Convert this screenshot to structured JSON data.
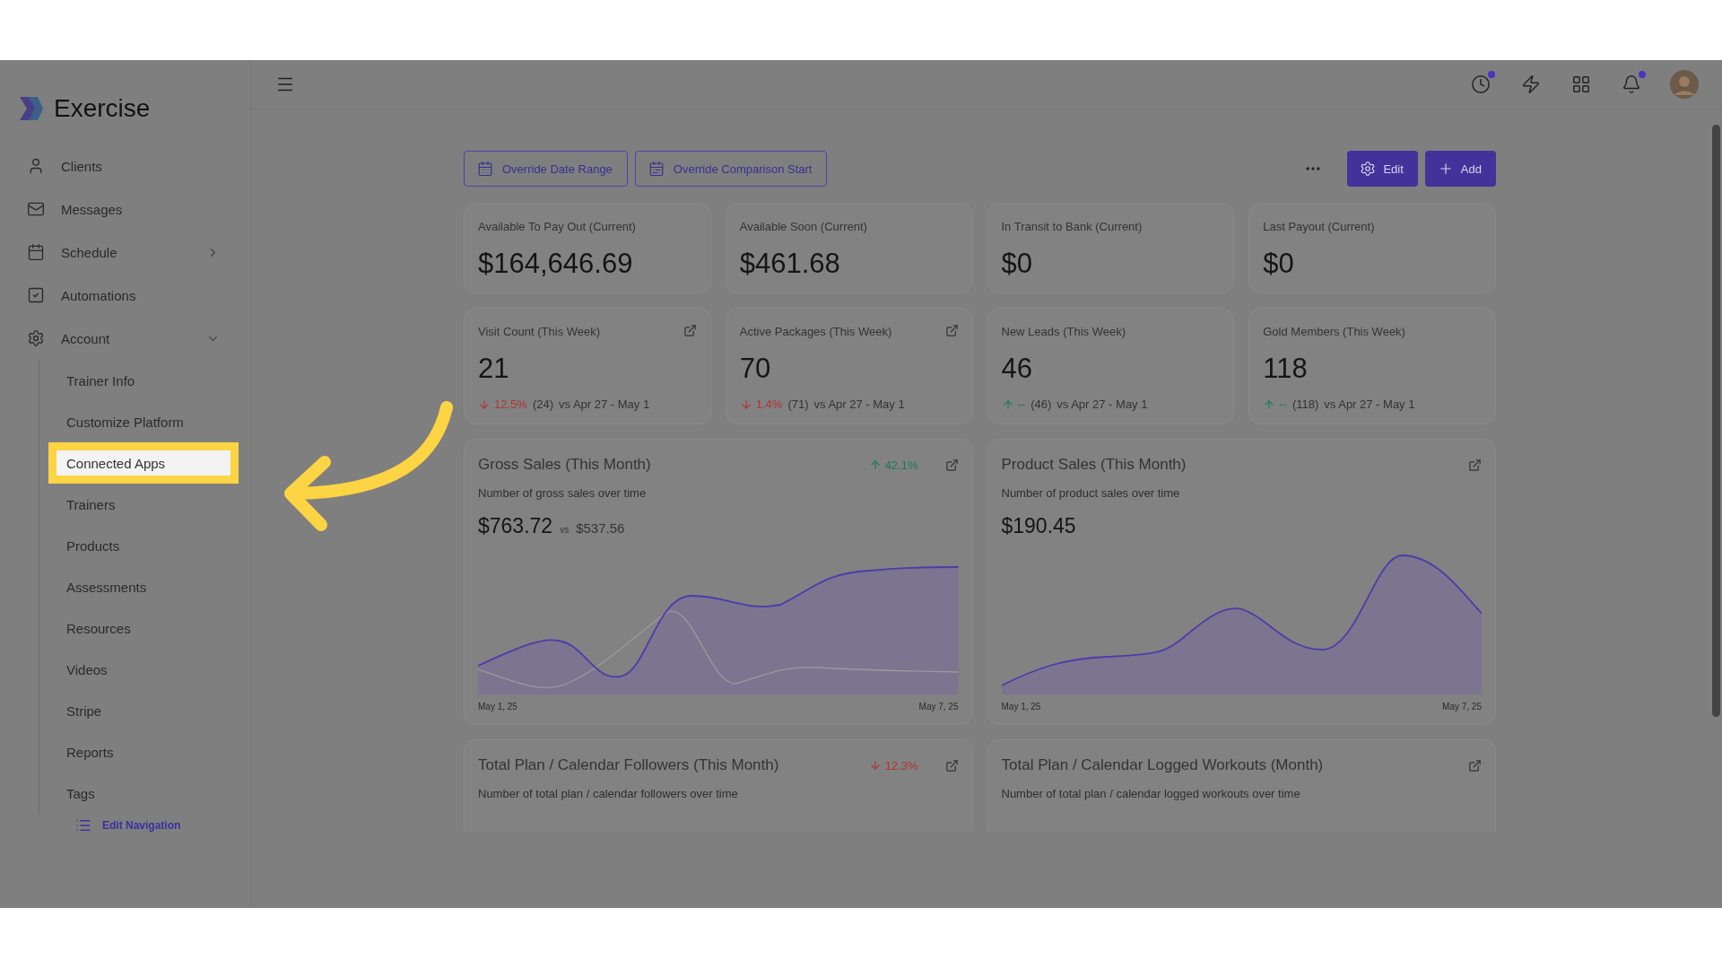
{
  "brand": {
    "name": "Exercise"
  },
  "nav": [
    {
      "label": "Clients"
    },
    {
      "label": "Messages"
    },
    {
      "label": "Schedule",
      "expanded": false
    },
    {
      "label": "Automations"
    },
    {
      "label": "Account",
      "expanded": true,
      "children": [
        {
          "label": "Trainer Info",
          "selected": false
        },
        {
          "label": "Customize Platform",
          "selected": false
        },
        {
          "label": "Connected Apps",
          "selected": true
        },
        {
          "label": "Trainers",
          "selected": false
        },
        {
          "label": "Products",
          "selected": false
        },
        {
          "label": "Assessments",
          "selected": false
        },
        {
          "label": "Resources",
          "selected": false
        },
        {
          "label": "Videos",
          "selected": false
        },
        {
          "label": "Stripe",
          "selected": false
        },
        {
          "label": "Reports",
          "selected": false
        },
        {
          "label": "Tags",
          "selected": false
        }
      ]
    }
  ],
  "edit_navigation": "Edit Navigation",
  "topbar": {
    "history_badge": true,
    "alerts_badge": true
  },
  "toolbar": {
    "buttons": [
      {
        "label": "Override Date Range"
      },
      {
        "label": "Override Comparison Start"
      }
    ],
    "edit": "Edit",
    "add": "Add"
  },
  "stats": [
    {
      "label": "Available To Pay Out (Current)",
      "value": "$164,646.69",
      "linked": false
    },
    {
      "label": "Available Soon (Current)",
      "value": "$461.68",
      "linked": false
    },
    {
      "label": "In Transit to Bank (Current)",
      "value": "$0",
      "linked": false
    },
    {
      "label": "Last Payout (Current)",
      "value": "$0",
      "linked": false
    },
    {
      "label": "Visit Count (This Week)",
      "value": "21",
      "linked": true,
      "trend": {
        "rising": false,
        "change": "12.5%",
        "count": "(24)",
        "compare": "vs Apr 27 - May 1"
      }
    },
    {
      "label": "Active Packages (This Week)",
      "value": "70",
      "linked": true,
      "trend": {
        "rising": false,
        "change": "1.4%",
        "count": "(71)",
        "compare": "vs Apr 27 - May 1"
      }
    },
    {
      "label": "New Leads (This Week)",
      "value": "46",
      "linked": false,
      "trend": {
        "rising": true,
        "change": "--",
        "count": "(46)",
        "compare": "vs Apr 27 - May 1"
      }
    },
    {
      "label": "Gold Members (This Week)",
      "value": "118",
      "linked": false,
      "trend": {
        "rising": true,
        "change": "--",
        "count": "(118)",
        "compare": "vs Apr 27 - May 1"
      }
    }
  ],
  "charts": [
    {
      "title": "Gross Sales (This Month)",
      "trend": {
        "rising": true,
        "change": "42.1%"
      },
      "subtitle": "Number of gross sales over time",
      "value": "$763.72",
      "vs": "vs",
      "compare_value": "$537.56",
      "x_start": "May 1, 25",
      "x_end": "May 7, 25"
    },
    {
      "title": "Product Sales (This Month)",
      "subtitle": "Number of product sales over time",
      "value": "$190.45",
      "x_start": "May 1, 25",
      "x_end": "May 7, 25"
    },
    {
      "title": "Total Plan / Calendar Followers (This Month)",
      "trend": {
        "rising": false,
        "change": "12.3%"
      },
      "subtitle": "Number of total plan / calendar followers over time"
    },
    {
      "title": "Total Plan / Calendar Logged Workouts (Month)",
      "subtitle": "Number of total plan / calendar logged workouts over time"
    }
  ]
}
